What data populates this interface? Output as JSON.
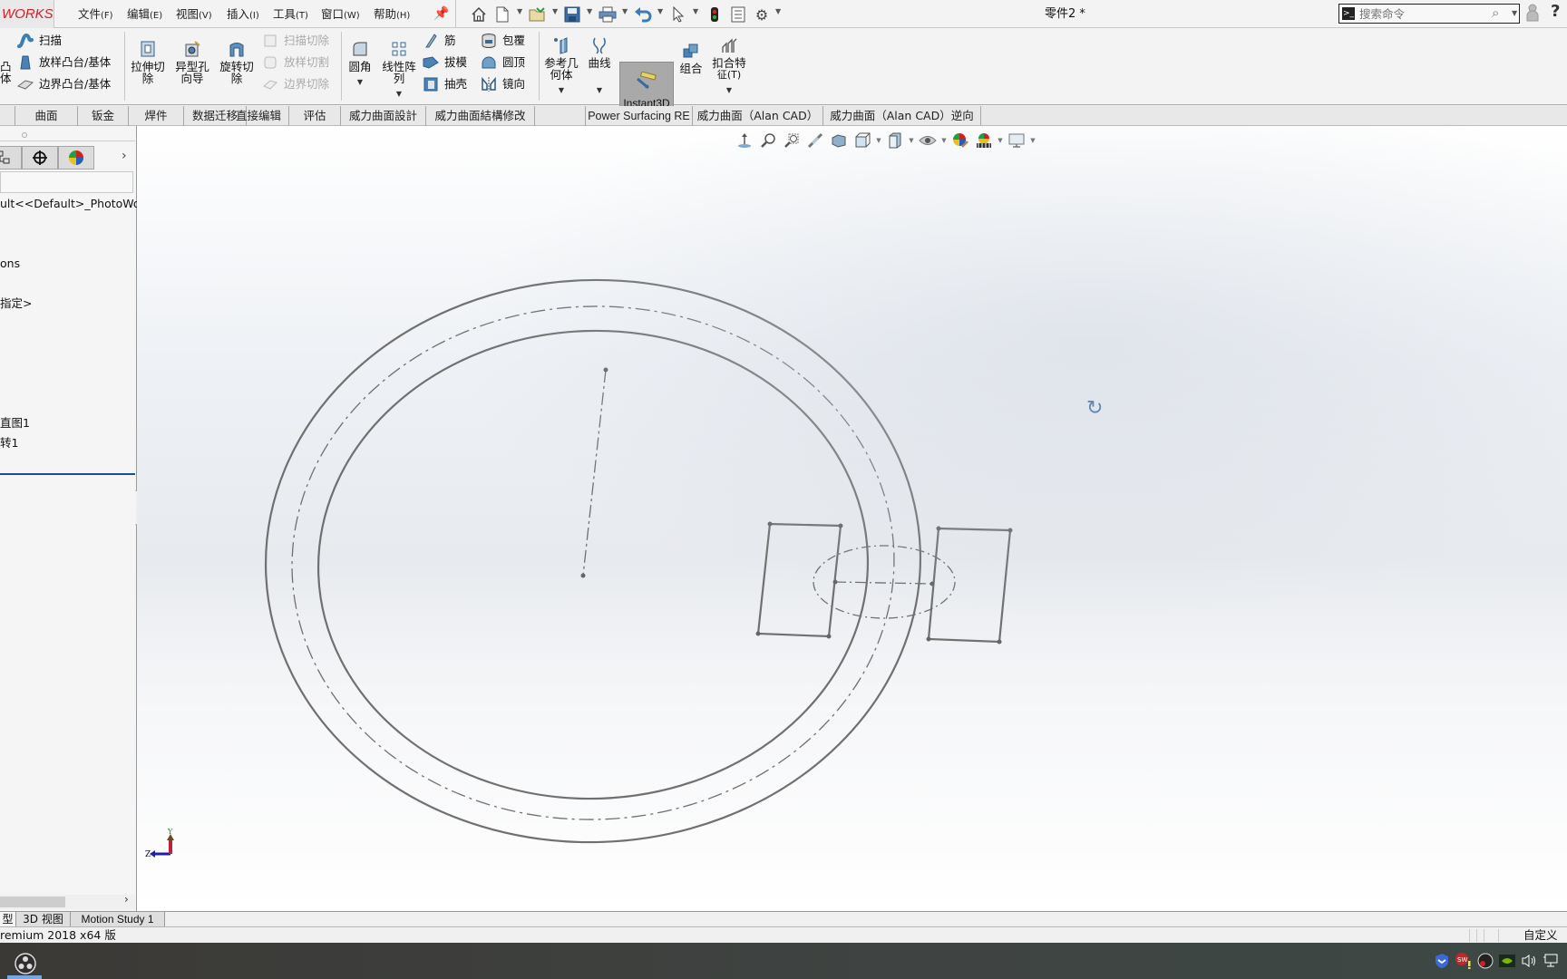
{
  "app": {
    "logo_text": "WORKS",
    "document_title": "零件2 *"
  },
  "menu": [
    {
      "label": "文件",
      "accel": "(F)"
    },
    {
      "label": "编辑",
      "accel": "(E)"
    },
    {
      "label": "视图",
      "accel": "(V)"
    },
    {
      "label": "插入",
      "accel": "(I)"
    },
    {
      "label": "工具",
      "accel": "(T)"
    },
    {
      "label": "窗口",
      "accel": "(W)"
    },
    {
      "label": "帮助",
      "accel": "(H)"
    }
  ],
  "quick_access": [
    "home-icon",
    "new-document-icon",
    "open-folder-icon",
    "save-icon",
    "print-icon",
    "undo-icon",
    "select-cursor-icon",
    "rebuild-traffic-light-icon",
    "file-properties-icon",
    "options-gear-icon"
  ],
  "search": {
    "placeholder": "搜索命令"
  },
  "ribbon": {
    "boss_partial": {
      "line1": "凸",
      "line2": "体"
    },
    "boss_small": [
      {
        "label": "扫描",
        "icon": "sweep-icon",
        "enabled": true
      },
      {
        "label": "放样凸台/基体",
        "icon": "loft-boss-icon",
        "enabled": true
      },
      {
        "label": "边界凸台/基体",
        "icon": "boundary-boss-icon",
        "enabled": true
      }
    ],
    "cut_big": [
      {
        "label": "拉伸切\n除",
        "line1": "拉伸切",
        "line2": "除",
        "icon": "extruded-cut-icon"
      },
      {
        "label": "异型孔\n向导",
        "line1": "异型孔",
        "line2": "向导",
        "icon": "hole-wizard-icon"
      },
      {
        "label": "旋转切\n除",
        "line1": "旋转切",
        "line2": "除",
        "icon": "revolved-cut-icon"
      }
    ],
    "cut_small": [
      {
        "label": "扫描切除",
        "icon": "swept-cut-icon",
        "enabled": false
      },
      {
        "label": "放样切割",
        "icon": "lofted-cut-icon",
        "enabled": false
      },
      {
        "label": "边界切除",
        "icon": "boundary-cut-icon",
        "enabled": false
      }
    ],
    "features_big": [
      {
        "line1": "圆角",
        "line2": "",
        "icon": "fillet-icon"
      },
      {
        "line1": "线性阵",
        "line2": "列",
        "icon": "linear-pattern-icon"
      }
    ],
    "features_small_a": [
      {
        "label": "筋",
        "icon": "rib-icon"
      },
      {
        "label": "拔模",
        "icon": "draft-icon"
      },
      {
        "label": "抽壳",
        "icon": "shell-icon"
      }
    ],
    "features_small_b": [
      {
        "label": "包覆",
        "icon": "wrap-icon"
      },
      {
        "label": "圆顶",
        "icon": "dome-icon"
      },
      {
        "label": "镜向",
        "icon": "mirror-icon"
      }
    ],
    "ref_geometry": {
      "line1": "参考几",
      "line2": "何体"
    },
    "curves": {
      "line1": "曲线"
    },
    "instant3d": {
      "label": "Instant3D",
      "active": true
    },
    "combine": {
      "line1": "组合"
    },
    "fastening": {
      "line1": "扣合特",
      "line2": "征(T)"
    }
  },
  "tabs": [
    {
      "label": ""
    },
    {
      "label": "曲面"
    },
    {
      "label": "钣金"
    },
    {
      "label": "焊件"
    },
    {
      "label": "数据迁移"
    },
    {
      "label": "直接编辑"
    },
    {
      "label": "评估"
    },
    {
      "label": "威力曲面設計"
    },
    {
      "label": "威力曲面結構修改"
    },
    {
      "label": ""
    },
    {
      "label": "Power Surfacing RE"
    },
    {
      "label": "威力曲面（Alan CAD）"
    },
    {
      "label": "威力曲面（Alan CAD）逆向"
    }
  ],
  "sidebar": {
    "tabs": [
      "configuration-manager-icon",
      "dimxpert-icon",
      "display-manager-icon"
    ],
    "tree": [
      {
        "label": "ult<<Default>_PhotoWork"
      },
      {
        "label": "ons"
      },
      {
        "label": "指定>"
      },
      {
        "label": "直图1"
      },
      {
        "label": "转1"
      }
    ]
  },
  "viewport": {
    "heads_up_toolbar": [
      "zoom-to-fit-icon",
      "zoom-to-area-icon",
      "previous-view-icon",
      "section-view-icon",
      "dynamic-annotation-icon",
      "view-orientation-icon",
      "display-style-icon",
      "hide-show-items-icon",
      "edit-appearance-icon",
      "apply-scene-icon",
      "view-settings-icon"
    ],
    "triad": {
      "x_label": "Z",
      "y_label": "Y"
    }
  },
  "bottom_tabs": [
    {
      "label": "型"
    },
    {
      "label": "3D 视图"
    },
    {
      "label": "Motion Study 1"
    }
  ],
  "status": {
    "left": "remium 2018 x64 版",
    "right": "自定义"
  },
  "taskbar": {
    "apps": [
      "obs-studio-icon"
    ],
    "tray": [
      "security-shield-icon",
      "solidworks-alert-icon",
      "obs-recording-icon",
      "nvidia-icon",
      "volume-icon",
      "network-icon"
    ]
  }
}
